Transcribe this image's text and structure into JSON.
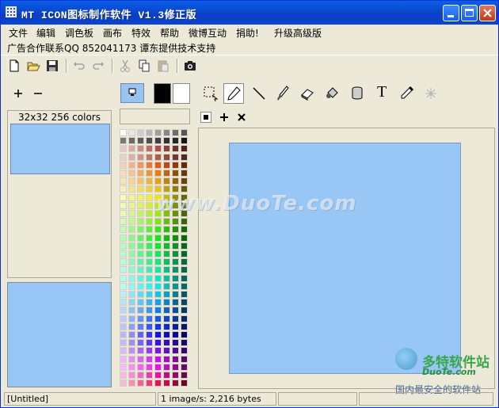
{
  "window": {
    "title": "MT ICON图标制作软件  V1.3修正版"
  },
  "menu": [
    "文件",
    "编辑",
    "调色板",
    "画布",
    "特效",
    "帮助",
    "微博互动",
    "捐助!",
    "升级高级版"
  ],
  "ad_text": "广告合作联系QQ 852041173 谭东提供技术支持",
  "toolbar": {
    "icons": [
      "new-file-icon",
      "open-folder-icon",
      "save-icon",
      "undo-icon",
      "redo-icon",
      "cut-icon",
      "copy-icon",
      "paste-icon",
      "screenshot-icon"
    ]
  },
  "left_panel": {
    "add_label": "+",
    "remove_label": "−",
    "size_label": "32x32 256 colors"
  },
  "drawing_tools": [
    "select-icon",
    "pencil-icon",
    "line-icon",
    "brush-icon",
    "eraser-icon",
    "fill-icon",
    "bucket-icon",
    "text-icon",
    "eyedropper-icon",
    "spray-icon"
  ],
  "text_tool_label": "T",
  "colors": {
    "canvas": "#99c7f5",
    "foreground": "#000000",
    "background": "#ffffff",
    "watermark_main": "www.DuoTe.com",
    "watermark_brand": "多特软件站",
    "watermark_site": "DuoTe.com",
    "watermark_tagline": "国内最安全的软件站"
  },
  "status": {
    "file": "[Untitled]",
    "info": "1 image/s: 2,216 bytes"
  }
}
